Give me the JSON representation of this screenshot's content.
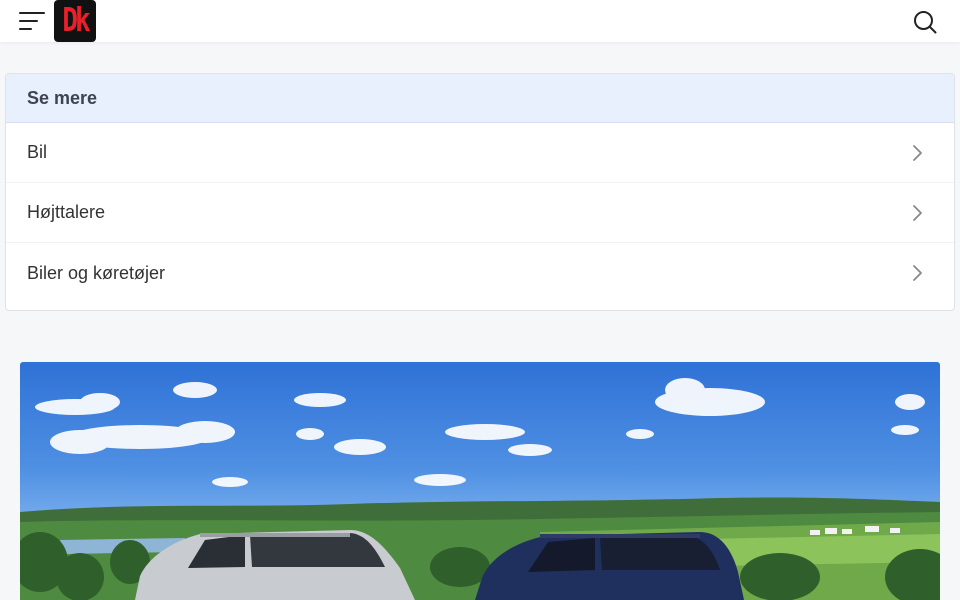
{
  "header": {
    "menu_icon": "hamburger-menu-icon",
    "logo_text": "Dk",
    "search_icon": "search-icon"
  },
  "see_more": {
    "title": "Se mere",
    "items": [
      {
        "label": "Bil",
        "icon": "chevron-right-icon"
      },
      {
        "label": "Højttalere",
        "icon": "chevron-right-icon"
      },
      {
        "label": "Biler og køretøjer",
        "icon": "chevron-right-icon"
      }
    ]
  },
  "hero_image": {
    "subject": "two cars in a green landscape under blue sky"
  },
  "colors": {
    "header_bg": "#ffffff",
    "card_head_bg": "#e8f0fd",
    "logo_bg": "#111111",
    "logo_fg": "#e8202a"
  }
}
